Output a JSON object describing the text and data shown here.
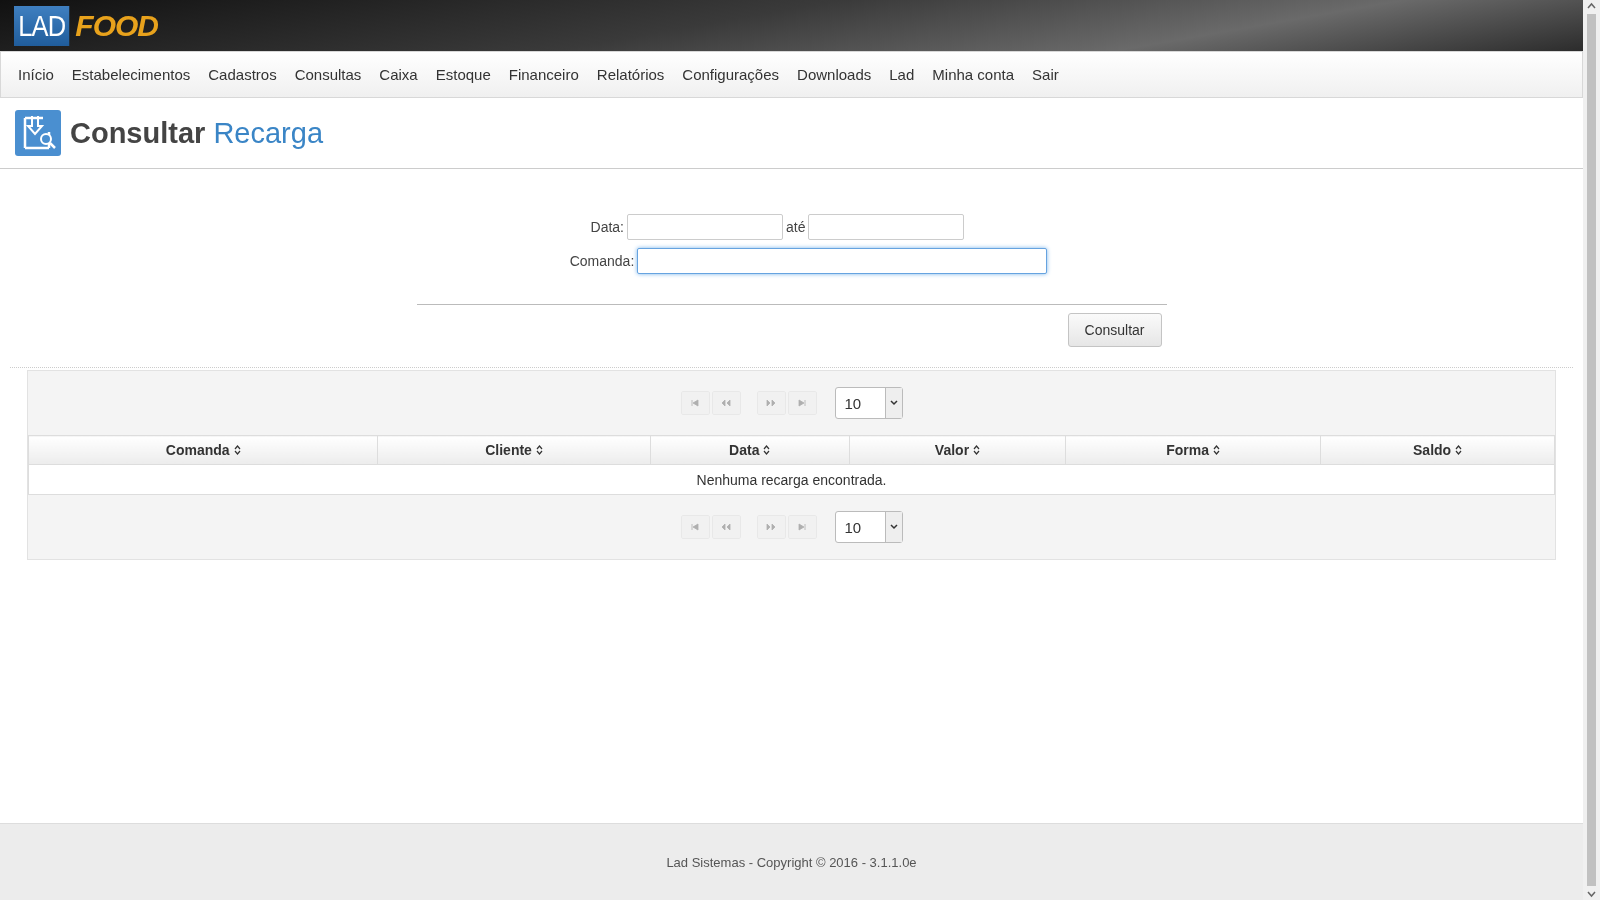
{
  "logo": {
    "part_1": "LAD",
    "part_2": "FOOD"
  },
  "menu": [
    "Início",
    "Estabelecimentos",
    "Cadastros",
    "Consultas",
    "Caixa",
    "Estoque",
    "Financeiro",
    "Relatórios",
    "Configurações",
    "Downloads",
    "Lad",
    "Minha conta",
    "Sair"
  ],
  "page_title": {
    "verb": "Consultar",
    "subject": "Recarga"
  },
  "form": {
    "date_label": "Data:",
    "date_to_label": "até",
    "comanda_label": "Comanda:",
    "comanda_focused": true,
    "submit": "Consultar"
  },
  "paginators": [
    {
      "buttons": [
        {
          "kind": "first",
          "disabled": true
        },
        {
          "kind": "prev",
          "disabled": true
        },
        {
          "kind": "next",
          "disabled": true
        },
        {
          "kind": "last",
          "disabled": true
        }
      ],
      "page_size": "10"
    },
    {
      "buttons": [
        {
          "kind": "first",
          "disabled": true
        },
        {
          "kind": "prev",
          "disabled": true
        },
        {
          "kind": "next",
          "disabled": true
        },
        {
          "kind": "last",
          "disabled": true
        }
      ],
      "page_size": "10"
    }
  ],
  "table": {
    "columns": [
      "Comanda",
      "Cliente",
      "Data",
      "Valor",
      "Forma",
      "Saldo"
    ],
    "empty_message": "Nenhuma recarga encontrada."
  },
  "footer": "Lad Sistemas - Copyright © 2016 - 3.1.1.0e"
}
